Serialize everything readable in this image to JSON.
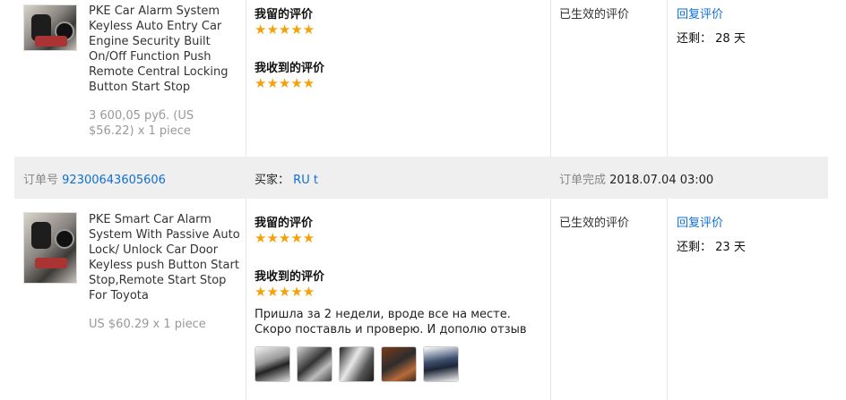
{
  "order1": {
    "product_title": "PKE Car Alarm System Keyless Auto Entry Car Engine Security Built On/Off Function Push Remote Central Locking Button Start Stop",
    "product_price": "3 600,05 руб. (US $56.22) x 1 piece",
    "my_review_label": "我留的评价",
    "my_review_stars": "★★★★★",
    "received_review_label": "我收到的评价",
    "received_review_stars": "★★★★★",
    "status": "已生效的评价",
    "reply_link": "回复评价",
    "remaining_label": "还剩：",
    "remaining_value": "28 天"
  },
  "order_bar": {
    "order_no_label": "订单号",
    "order_no": "92300643605606",
    "buyer_label": "买家：",
    "buyer_name": "RU t",
    "completed_label": "订单完成",
    "completed_date": "2018.07.04 03:00"
  },
  "order2": {
    "product_title": "PKE Smart Car Alarm System With Passive Auto Lock/ Unlock Car Door Keyless push Button Start Stop,Remote Start Stop For Toyota",
    "product_price": "US $60.29 x 1 piece",
    "my_review_label": "我留的评价",
    "my_review_stars": "★★★★★",
    "received_review_label": "我收到的评价",
    "received_review_stars": "★★★★★",
    "review_text": "Пришла за 2 недели, вроде все на месте. Скоро поставль и проверю. И дополю отзыв",
    "status": "已生效的评价",
    "reply_link": "回复评价",
    "remaining_label": "还剩：",
    "remaining_value": "23 天",
    "review_photos": [
      "photo-1",
      "photo-2",
      "photo-3",
      "photo-4",
      "photo-5"
    ]
  },
  "colors": {
    "link": "#0e6fd6",
    "star": "#f5a20a",
    "order_bar_bg": "#efefef"
  }
}
